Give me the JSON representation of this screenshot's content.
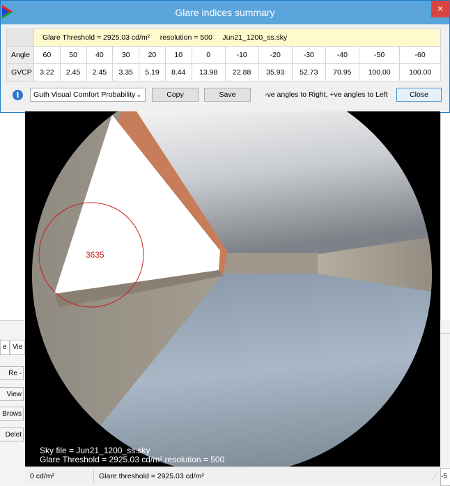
{
  "window": {
    "title": "Glare indices summary",
    "close_glyph": "×"
  },
  "summary": {
    "threshold_text": "Glare Threshold = 2925.03 cd/m²",
    "resolution_text": "resolution = 500",
    "sky_file_text": "Jun21_1200_ss.sky"
  },
  "table": {
    "angle_label": "Angle",
    "gvcp_label": "GVCP",
    "angles": [
      "60",
      "50",
      "40",
      "30",
      "20",
      "10",
      "0",
      "-10",
      "-20",
      "-30",
      "-40",
      "-50",
      "-60"
    ],
    "gvcp": [
      "3.22",
      "2.45",
      "2.45",
      "3.35",
      "5.19",
      "8.44",
      "13.98",
      "22.88",
      "35.93",
      "52.73",
      "70.95",
      "100.00",
      "100.00"
    ]
  },
  "controls": {
    "metric_selected": "Guth Visual Comfort Probability",
    "copy_label": "Copy",
    "save_label": "Save",
    "angle_note": "-ve angles to Right, +ve angles to Left",
    "close_label": "Close"
  },
  "viewer": {
    "glare_source_value": "3635",
    "sky_file_line": "Sky file = Jun21_1200_ss.sky",
    "threshold_line": "Glare Threshold = 2925.03 cd/m²  resolution = 500"
  },
  "status": {
    "left_text": "0 cd/m²",
    "right_text": "Glare threshold = 2925.03 cd/m²"
  },
  "background": {
    "tab_1": "e",
    "tab_2": "Vie",
    "item_1": "Re - Na",
    "item_2": "View",
    "item_3": "Brows",
    "item_4": "Delet",
    "right_box": "-5"
  },
  "colors": {
    "titlebar": "#5aa6dc",
    "close_red": "#d8453f",
    "header_strip": "#fffacd",
    "glare_circle": "#c81e1e"
  }
}
